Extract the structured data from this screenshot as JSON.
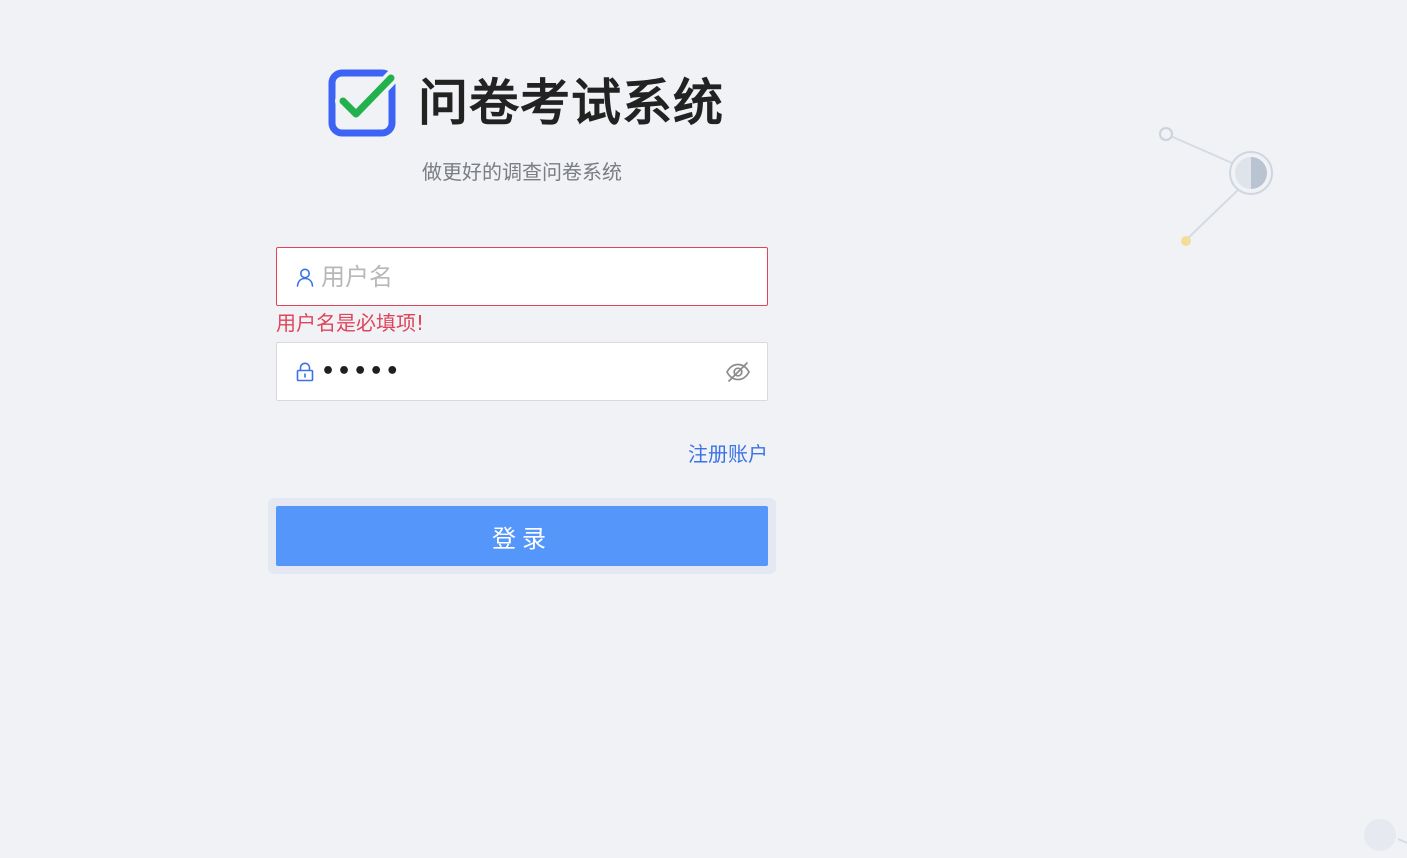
{
  "brand": {
    "title": "问卷考试系统",
    "subtitle": "做更好的调查问卷系统",
    "logo_icon": "checkbox-checked-icon",
    "logo_color": "#3d63f5",
    "check_color": "#22b14c"
  },
  "form": {
    "username": {
      "placeholder": "用户名",
      "value": "",
      "error": "用户名是必填项!",
      "icon": "user-icon"
    },
    "password": {
      "value": "•••••",
      "icon": "lock-icon",
      "toggle_icon": "eye-hidden-icon"
    },
    "register_label": "注册账户",
    "login_label": "登录"
  },
  "colors": {
    "background": "#f0f2f5",
    "primary": "#5596fa",
    "link": "#3b73e6",
    "error": "#e0445a"
  }
}
